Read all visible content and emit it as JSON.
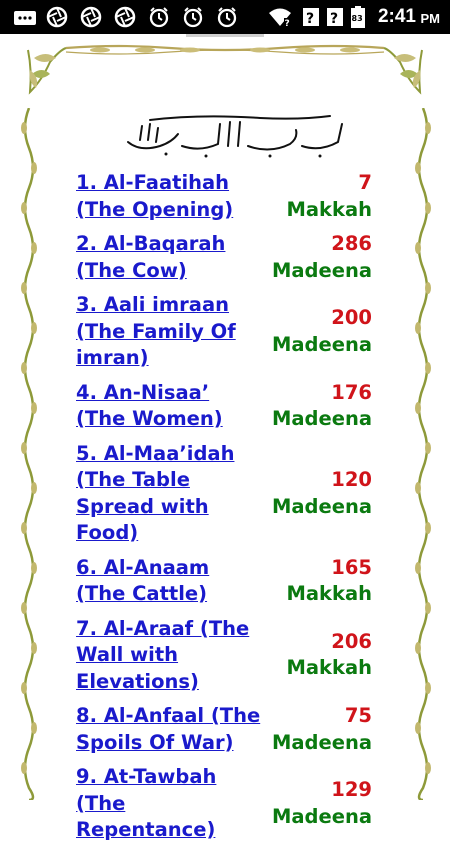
{
  "status_bar": {
    "time": "2:41",
    "ampm": "PM",
    "battery": "83",
    "icons": [
      "notification-icon",
      "aperture-icon",
      "aperture-icon",
      "aperture-icon",
      "alarm-icon",
      "alarm-icon",
      "alarm-icon",
      "wifi-icon",
      "signal-unknown-icon",
      "signal-unknown-icon",
      "battery-icon"
    ]
  },
  "surahs": [
    {
      "name": "1. Al-Faatihah (The Opening)",
      "verses": "7",
      "place": "Makkah"
    },
    {
      "name": "2. Al-Baqarah (The Cow)",
      "verses": "286",
      "place": "Madeena"
    },
    {
      "name": "3. Aali imraan (The Family Of imran)",
      "verses": "200",
      "place": "Madeena"
    },
    {
      "name": "4. An-Nisaa’ (The Women)",
      "verses": "176",
      "place": "Madeena"
    },
    {
      "name": "5. Al-Maa’idah (The Table Spread with Food)",
      "verses": "120",
      "place": "Madeena"
    },
    {
      "name": "6. Al-Anaam (The Cattle)",
      "verses": "165",
      "place": "Makkah"
    },
    {
      "name": "7. Al-Araaf (The Wall with Elevations)",
      "verses": "206",
      "place": "Makkah"
    },
    {
      "name": "8. Al-Anfaal (The Spoils Of War)",
      "verses": "75",
      "place": "Madeena"
    },
    {
      "name": "9. At-Tawbah (The Repentance)",
      "verses": "129",
      "place": "Madeena"
    }
  ],
  "colors": {
    "link": "#1a1acc",
    "verses": "#d0141a",
    "place": "#0b7a10",
    "ornament": "#b8a65a",
    "vine": "#8e9a3a"
  }
}
